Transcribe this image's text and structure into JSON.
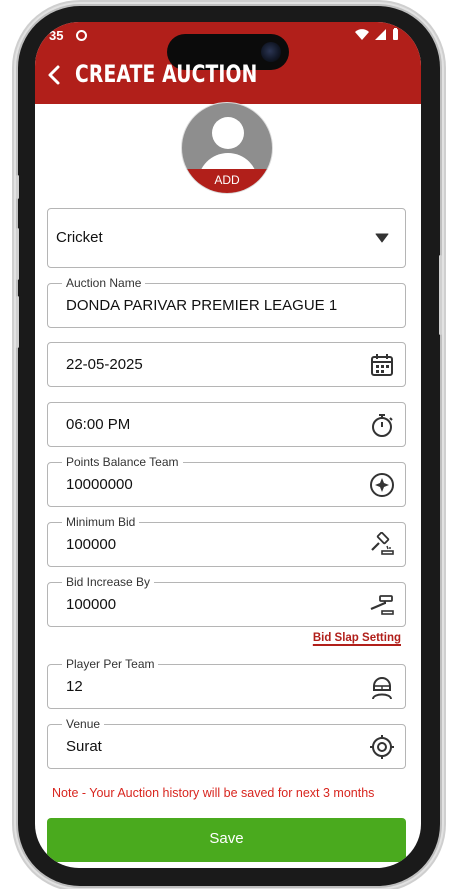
{
  "status_bar": {
    "time": "35",
    "icons": [
      "app-notification-icon",
      "wifi-icon",
      "signal-icon",
      "battery-icon"
    ]
  },
  "header": {
    "title": "CREATE AUCTION",
    "back_icon": "back-arrow-icon",
    "background": "#b11f1a"
  },
  "avatar": {
    "add_label": "ADD"
  },
  "form": {
    "sport": {
      "value": "Cricket"
    },
    "auction_name": {
      "label": "Auction Name",
      "value": "DONDA PARIVAR PREMIER LEAGUE 1"
    },
    "date": {
      "value": "22-05-2025",
      "icon": "calendar-icon"
    },
    "time": {
      "value": "06:00 PM",
      "icon": "stopwatch-icon"
    },
    "points_balance": {
      "label": "Points Balance Team",
      "value": "10000000",
      "icon": "compass-icon"
    },
    "minimum_bid": {
      "label": "Minimum Bid",
      "value": "100000",
      "icon": "gavel-icon"
    },
    "bid_increase": {
      "label": "Bid Increase By",
      "value": "100000",
      "icon": "gavel-icon"
    },
    "bid_slap_link": "Bid Slap Setting",
    "player_per_team": {
      "label": "Player Per Team",
      "value": "12",
      "icon": "player-icon"
    },
    "venue": {
      "label": "Venue",
      "value": "Surat",
      "icon": "target-icon"
    }
  },
  "note": "Note - Your Auction history will be saved for next 3 months",
  "save_button": "Save",
  "colors": {
    "accent": "#b11f1a",
    "save": "#4aaa1e",
    "note": "#d8261f"
  }
}
